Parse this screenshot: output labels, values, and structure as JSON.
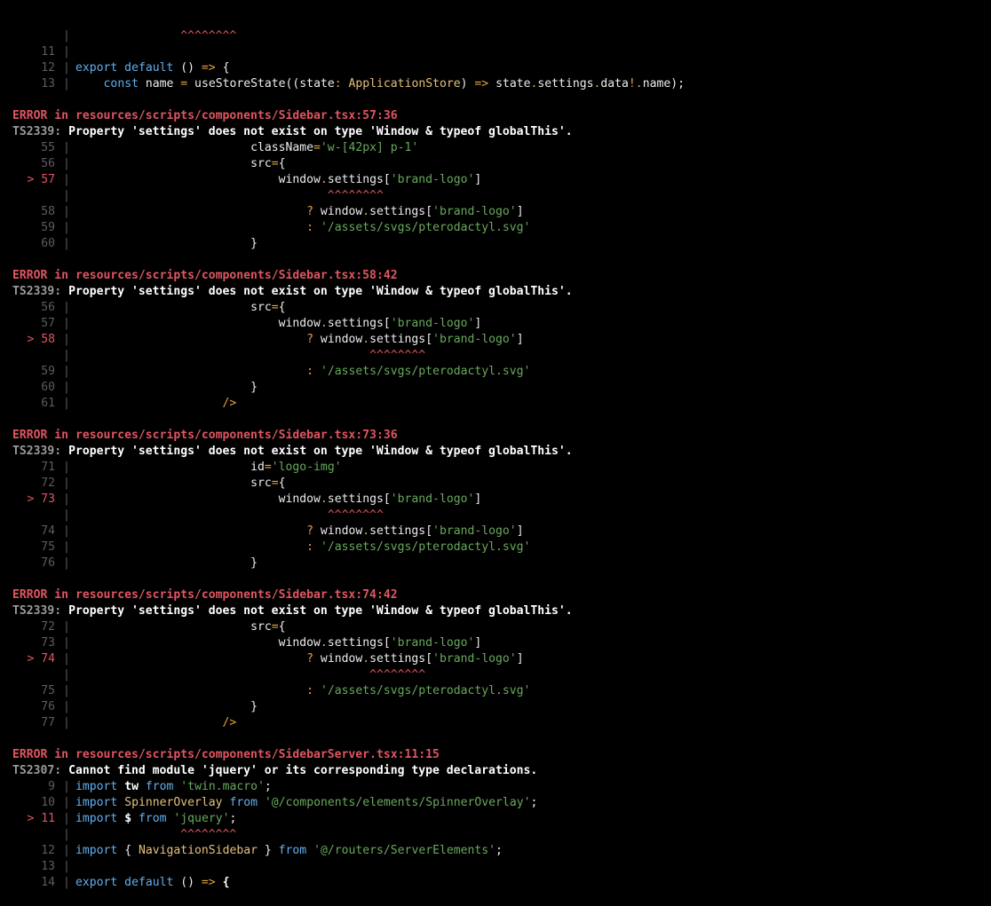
{
  "colors": {
    "background": "#000000",
    "error": "#e05561",
    "keyword": "#61afef",
    "string": "#68a95c",
    "operator": "#e5a33b",
    "type": "#e5c07b",
    "gutter": "#5c5c5c"
  },
  "lines": [
    {
      "kind": "code",
      "gutter": "",
      "current": false,
      "tokens": [
        {
          "t": "               ",
          "c": "plain"
        },
        {
          "t": "^^^^^^^^",
          "c": "caret"
        }
      ]
    },
    {
      "kind": "code",
      "gutter": "11",
      "current": false,
      "tokens": []
    },
    {
      "kind": "code",
      "gutter": "12",
      "current": false,
      "tokens": [
        {
          "t": "export default",
          "c": "kw"
        },
        {
          "t": " () ",
          "c": "plain"
        },
        {
          "t": "=>",
          "c": "op"
        },
        {
          "t": " {",
          "c": "plain"
        }
      ]
    },
    {
      "kind": "code",
      "gutter": "13",
      "current": false,
      "tokens": [
        {
          "t": "    ",
          "c": "plain"
        },
        {
          "t": "const",
          "c": "kw"
        },
        {
          "t": " name ",
          "c": "plain"
        },
        {
          "t": "=",
          "c": "op"
        },
        {
          "t": " useStoreState((state",
          "c": "plain"
        },
        {
          "t": ":",
          "c": "op"
        },
        {
          "t": " ",
          "c": "plain"
        },
        {
          "t": "ApplicationStore",
          "c": "type"
        },
        {
          "t": ") ",
          "c": "plain"
        },
        {
          "t": "=>",
          "c": "op"
        },
        {
          "t": " state",
          "c": "plain"
        },
        {
          "t": ".",
          "c": "op"
        },
        {
          "t": "settings",
          "c": "plain"
        },
        {
          "t": ".",
          "c": "op"
        },
        {
          "t": "data",
          "c": "plain"
        },
        {
          "t": "!.",
          "c": "op"
        },
        {
          "t": "name);",
          "c": "plain"
        }
      ]
    },
    {
      "kind": "blank"
    },
    {
      "kind": "error",
      "label": "ERROR in",
      "path": "resources/scripts/components/Sidebar.tsx:57:36"
    },
    {
      "kind": "ts",
      "code": "TS2339:",
      "msg": "Property 'settings' does not exist on type 'Window & typeof globalThis'."
    },
    {
      "kind": "code",
      "gutter": "55",
      "current": false,
      "tokens": [
        {
          "t": "                         className",
          "c": "plain"
        },
        {
          "t": "=",
          "c": "op"
        },
        {
          "t": "'w-[42px] p-1'",
          "c": "str"
        }
      ]
    },
    {
      "kind": "code",
      "gutter": "56",
      "current": false,
      "tokens": [
        {
          "t": "                         src",
          "c": "plain"
        },
        {
          "t": "=",
          "c": "op"
        },
        {
          "t": "{",
          "c": "plain"
        }
      ]
    },
    {
      "kind": "code",
      "gutter": "> 57",
      "current": true,
      "tokens": [
        {
          "t": "                             window",
          "c": "plain"
        },
        {
          "t": ".",
          "c": "op"
        },
        {
          "t": "settings[",
          "c": "plain"
        },
        {
          "t": "'brand-logo'",
          "c": "str"
        },
        {
          "t": "]",
          "c": "plain"
        }
      ]
    },
    {
      "kind": "code",
      "gutter": "",
      "current": false,
      "tokens": [
        {
          "t": "                                    ",
          "c": "plain"
        },
        {
          "t": "^^^^^^^^",
          "c": "caret"
        }
      ]
    },
    {
      "kind": "code",
      "gutter": "58",
      "current": false,
      "tokens": [
        {
          "t": "                                 ",
          "c": "plain"
        },
        {
          "t": "?",
          "c": "op"
        },
        {
          "t": " window",
          "c": "plain"
        },
        {
          "t": ".",
          "c": "op"
        },
        {
          "t": "settings[",
          "c": "plain"
        },
        {
          "t": "'brand-logo'",
          "c": "str"
        },
        {
          "t": "]",
          "c": "plain"
        }
      ]
    },
    {
      "kind": "code",
      "gutter": "59",
      "current": false,
      "tokens": [
        {
          "t": "                                 ",
          "c": "plain"
        },
        {
          "t": ":",
          "c": "op"
        },
        {
          "t": " ",
          "c": "plain"
        },
        {
          "t": "'/assets/svgs/pterodactyl.svg'",
          "c": "str"
        }
      ]
    },
    {
      "kind": "code",
      "gutter": "60",
      "current": false,
      "tokens": [
        {
          "t": "                         }",
          "c": "plain"
        }
      ]
    },
    {
      "kind": "blank"
    },
    {
      "kind": "error",
      "label": "ERROR in",
      "path": "resources/scripts/components/Sidebar.tsx:58:42"
    },
    {
      "kind": "ts",
      "code": "TS2339:",
      "msg": "Property 'settings' does not exist on type 'Window & typeof globalThis'."
    },
    {
      "kind": "code",
      "gutter": "56",
      "current": false,
      "tokens": [
        {
          "t": "                         src",
          "c": "plain"
        },
        {
          "t": "=",
          "c": "op"
        },
        {
          "t": "{",
          "c": "plain"
        }
      ]
    },
    {
      "kind": "code",
      "gutter": "57",
      "current": false,
      "tokens": [
        {
          "t": "                             window",
          "c": "plain"
        },
        {
          "t": ".",
          "c": "op"
        },
        {
          "t": "settings[",
          "c": "plain"
        },
        {
          "t": "'brand-logo'",
          "c": "str"
        },
        {
          "t": "]",
          "c": "plain"
        }
      ]
    },
    {
      "kind": "code",
      "gutter": "> 58",
      "current": true,
      "tokens": [
        {
          "t": "                                 ",
          "c": "plain"
        },
        {
          "t": "?",
          "c": "op"
        },
        {
          "t": " window",
          "c": "plain"
        },
        {
          "t": ".",
          "c": "op"
        },
        {
          "t": "settings[",
          "c": "plain"
        },
        {
          "t": "'brand-logo'",
          "c": "str"
        },
        {
          "t": "]",
          "c": "plain"
        }
      ]
    },
    {
      "kind": "code",
      "gutter": "",
      "current": false,
      "tokens": [
        {
          "t": "                                          ",
          "c": "plain"
        },
        {
          "t": "^^^^^^^^",
          "c": "caret"
        }
      ]
    },
    {
      "kind": "code",
      "gutter": "59",
      "current": false,
      "tokens": [
        {
          "t": "                                 ",
          "c": "plain"
        },
        {
          "t": ":",
          "c": "op"
        },
        {
          "t": " ",
          "c": "plain"
        },
        {
          "t": "'/assets/svgs/pterodactyl.svg'",
          "c": "str"
        }
      ]
    },
    {
      "kind": "code",
      "gutter": "60",
      "current": false,
      "tokens": [
        {
          "t": "                         }",
          "c": "plain"
        }
      ]
    },
    {
      "kind": "code",
      "gutter": "61",
      "current": false,
      "tokens": [
        {
          "t": "                     ",
          "c": "plain"
        },
        {
          "t": "/>",
          "c": "op"
        }
      ]
    },
    {
      "kind": "blank"
    },
    {
      "kind": "error",
      "label": "ERROR in",
      "path": "resources/scripts/components/Sidebar.tsx:73:36"
    },
    {
      "kind": "ts",
      "code": "TS2339:",
      "msg": "Property 'settings' does not exist on type 'Window & typeof globalThis'."
    },
    {
      "kind": "code",
      "gutter": "71",
      "current": false,
      "tokens": [
        {
          "t": "                         id",
          "c": "plain"
        },
        {
          "t": "=",
          "c": "op"
        },
        {
          "t": "'logo-img'",
          "c": "str"
        }
      ]
    },
    {
      "kind": "code",
      "gutter": "72",
      "current": false,
      "tokens": [
        {
          "t": "                         src",
          "c": "plain"
        },
        {
          "t": "=",
          "c": "op"
        },
        {
          "t": "{",
          "c": "plain"
        }
      ]
    },
    {
      "kind": "code",
      "gutter": "> 73",
      "current": true,
      "tokens": [
        {
          "t": "                             window",
          "c": "plain"
        },
        {
          "t": ".",
          "c": "op"
        },
        {
          "t": "settings[",
          "c": "plain"
        },
        {
          "t": "'brand-logo'",
          "c": "str"
        },
        {
          "t": "]",
          "c": "plain"
        }
      ]
    },
    {
      "kind": "code",
      "gutter": "",
      "current": false,
      "tokens": [
        {
          "t": "                                    ",
          "c": "plain"
        },
        {
          "t": "^^^^^^^^",
          "c": "caret"
        }
      ]
    },
    {
      "kind": "code",
      "gutter": "74",
      "current": false,
      "tokens": [
        {
          "t": "                                 ",
          "c": "plain"
        },
        {
          "t": "?",
          "c": "op"
        },
        {
          "t": " window",
          "c": "plain"
        },
        {
          "t": ".",
          "c": "op"
        },
        {
          "t": "settings[",
          "c": "plain"
        },
        {
          "t": "'brand-logo'",
          "c": "str"
        },
        {
          "t": "]",
          "c": "plain"
        }
      ]
    },
    {
      "kind": "code",
      "gutter": "75",
      "current": false,
      "tokens": [
        {
          "t": "                                 ",
          "c": "plain"
        },
        {
          "t": ":",
          "c": "op"
        },
        {
          "t": " ",
          "c": "plain"
        },
        {
          "t": "'/assets/svgs/pterodactyl.svg'",
          "c": "str"
        }
      ]
    },
    {
      "kind": "code",
      "gutter": "76",
      "current": false,
      "tokens": [
        {
          "t": "                         }",
          "c": "plain"
        }
      ]
    },
    {
      "kind": "blank"
    },
    {
      "kind": "error",
      "label": "ERROR in",
      "path": "resources/scripts/components/Sidebar.tsx:74:42"
    },
    {
      "kind": "ts",
      "code": "TS2339:",
      "msg": "Property 'settings' does not exist on type 'Window & typeof globalThis'."
    },
    {
      "kind": "code",
      "gutter": "72",
      "current": false,
      "tokens": [
        {
          "t": "                         src",
          "c": "plain"
        },
        {
          "t": "=",
          "c": "op"
        },
        {
          "t": "{",
          "c": "plain"
        }
      ]
    },
    {
      "kind": "code",
      "gutter": "73",
      "current": false,
      "tokens": [
        {
          "t": "                             window",
          "c": "plain"
        },
        {
          "t": ".",
          "c": "op"
        },
        {
          "t": "settings[",
          "c": "plain"
        },
        {
          "t": "'brand-logo'",
          "c": "str"
        },
        {
          "t": "]",
          "c": "plain"
        }
      ]
    },
    {
      "kind": "code",
      "gutter": "> 74",
      "current": true,
      "tokens": [
        {
          "t": "                                 ",
          "c": "plain"
        },
        {
          "t": "?",
          "c": "op"
        },
        {
          "t": " window",
          "c": "plain"
        },
        {
          "t": ".",
          "c": "op"
        },
        {
          "t": "settings[",
          "c": "plain"
        },
        {
          "t": "'brand-logo'",
          "c": "str"
        },
        {
          "t": "]",
          "c": "plain"
        }
      ]
    },
    {
      "kind": "code",
      "gutter": "",
      "current": false,
      "tokens": [
        {
          "t": "                                          ",
          "c": "plain"
        },
        {
          "t": "^^^^^^^^",
          "c": "caret"
        }
      ]
    },
    {
      "kind": "code",
      "gutter": "75",
      "current": false,
      "tokens": [
        {
          "t": "                                 ",
          "c": "plain"
        },
        {
          "t": ":",
          "c": "op"
        },
        {
          "t": " ",
          "c": "plain"
        },
        {
          "t": "'/assets/svgs/pterodactyl.svg'",
          "c": "str"
        }
      ]
    },
    {
      "kind": "code",
      "gutter": "76",
      "current": false,
      "tokens": [
        {
          "t": "                         }",
          "c": "plain"
        }
      ]
    },
    {
      "kind": "code",
      "gutter": "77",
      "current": false,
      "tokens": [
        {
          "t": "                     ",
          "c": "plain"
        },
        {
          "t": "/>",
          "c": "op"
        }
      ]
    },
    {
      "kind": "blank"
    },
    {
      "kind": "error",
      "label": "ERROR in",
      "path": "resources/scripts/components/SidebarServer.tsx:11:15"
    },
    {
      "kind": "ts",
      "code": "TS2307:",
      "msg": "Cannot find module 'jquery' or its corresponding type declarations."
    },
    {
      "kind": "code",
      "gutter": "9",
      "current": false,
      "tokens": [
        {
          "t": "import",
          "c": "kw"
        },
        {
          "t": " tw ",
          "c": "bold"
        },
        {
          "t": "from",
          "c": "kw"
        },
        {
          "t": " ",
          "c": "plain"
        },
        {
          "t": "'twin.macro'",
          "c": "str"
        },
        {
          "t": ";",
          "c": "plain"
        }
      ]
    },
    {
      "kind": "code",
      "gutter": "10",
      "current": false,
      "tokens": [
        {
          "t": "import",
          "c": "kw"
        },
        {
          "t": " ",
          "c": "plain"
        },
        {
          "t": "SpinnerOverlay",
          "c": "type"
        },
        {
          "t": " ",
          "c": "plain"
        },
        {
          "t": "from",
          "c": "kw"
        },
        {
          "t": " ",
          "c": "plain"
        },
        {
          "t": "'@/components/elements/SpinnerOverlay'",
          "c": "str"
        },
        {
          "t": ";",
          "c": "plain"
        }
      ]
    },
    {
      "kind": "code",
      "gutter": "> 11",
      "current": true,
      "tokens": [
        {
          "t": "import",
          "c": "kw"
        },
        {
          "t": " $ ",
          "c": "bold"
        },
        {
          "t": "from",
          "c": "kw"
        },
        {
          "t": " ",
          "c": "plain"
        },
        {
          "t": "'jquery'",
          "c": "str"
        },
        {
          "t": ";",
          "c": "plain"
        }
      ]
    },
    {
      "kind": "code",
      "gutter": "",
      "current": false,
      "tokens": [
        {
          "t": "               ",
          "c": "plain"
        },
        {
          "t": "^^^^^^^^",
          "c": "caret"
        }
      ]
    },
    {
      "kind": "code",
      "gutter": "12",
      "current": false,
      "tokens": [
        {
          "t": "import",
          "c": "kw"
        },
        {
          "t": " { ",
          "c": "plain"
        },
        {
          "t": "NavigationSidebar",
          "c": "type"
        },
        {
          "t": " } ",
          "c": "plain"
        },
        {
          "t": "from",
          "c": "kw"
        },
        {
          "t": " ",
          "c": "plain"
        },
        {
          "t": "'@/routers/ServerElements'",
          "c": "str"
        },
        {
          "t": ";",
          "c": "plain"
        }
      ]
    },
    {
      "kind": "code",
      "gutter": "13",
      "current": false,
      "tokens": []
    },
    {
      "kind": "code",
      "gutter": "14",
      "current": false,
      "tokens": [
        {
          "t": "export default",
          "c": "kw"
        },
        {
          "t": " () ",
          "c": "plain"
        },
        {
          "t": "=>",
          "c": "op"
        },
        {
          "t": " {",
          "c": "bold"
        }
      ]
    }
  ]
}
